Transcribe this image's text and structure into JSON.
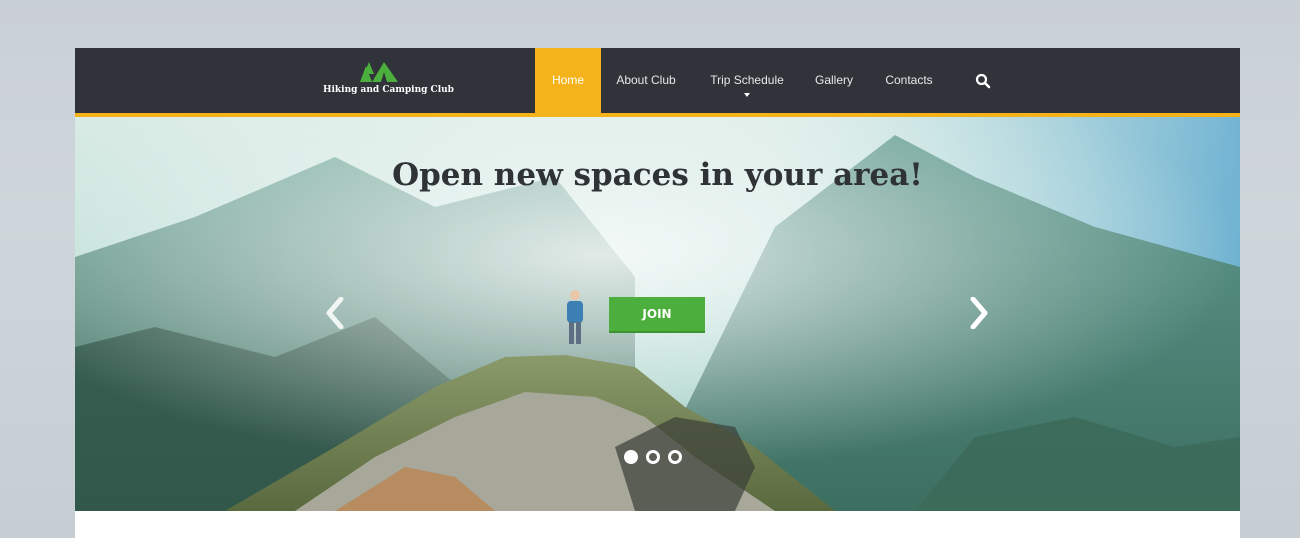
{
  "brand": {
    "name": "Hiking and Camping Club",
    "logo_icon": "tent-trees-logo",
    "logo_color": "#4cae3c"
  },
  "nav": {
    "items": [
      {
        "label": "Home",
        "active": true
      },
      {
        "label": "About Club",
        "active": false
      },
      {
        "label": "Trip Schedule",
        "active": false,
        "has_dropdown": true
      },
      {
        "label": "Gallery",
        "active": false
      },
      {
        "label": "Contacts",
        "active": false
      }
    ],
    "search_icon": "search-icon"
  },
  "hero": {
    "title": "Open new spaces in your area!",
    "cta_label": "JOIN",
    "prev_icon": "chevron-left-icon",
    "next_icon": "chevron-right-icon",
    "slides_total": 3,
    "active_slide": 1
  },
  "colors": {
    "nav_background": "#30333a",
    "accent": "#f4b31a",
    "cta": "#4cae3c"
  }
}
